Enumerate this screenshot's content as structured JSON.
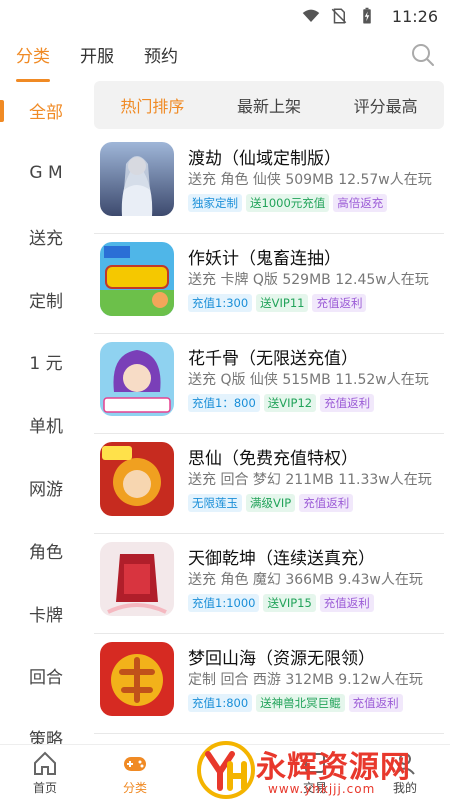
{
  "status_bar": {
    "time": "11:26",
    "icons": [
      "wifi-icon",
      "no-sim-icon",
      "battery-icon"
    ]
  },
  "top_tabs": [
    {
      "label": "分类",
      "active": true
    },
    {
      "label": "开服",
      "active": false
    },
    {
      "label": "预约",
      "active": false
    }
  ],
  "sidebar": {
    "items": [
      "全部",
      "G M",
      "送充",
      "定制",
      "1 元",
      "单机",
      "网游",
      "角色",
      "卡牌",
      "回合",
      "策略"
    ]
  },
  "sort_tabs": [
    {
      "label": "热门排序",
      "active": true
    },
    {
      "label": "最新上架",
      "active": false
    },
    {
      "label": "评分最高",
      "active": false
    }
  ],
  "games": [
    {
      "title": "渡劫（仙域定制版）",
      "meta": "送充 角色 仙侠  509MB  12.57w人在玩",
      "tags": [
        {
          "text": "独家定制",
          "color": "blue"
        },
        {
          "text": "送1000元充值",
          "color": "green"
        },
        {
          "text": "高倍返充",
          "color": "purple"
        }
      ]
    },
    {
      "title": "作妖计（鬼畜连抽）",
      "meta": "送充 卡牌 Q版  529MB  12.45w人在玩",
      "tags": [
        {
          "text": "充值1:300",
          "color": "blue"
        },
        {
          "text": "送VIP11",
          "color": "green"
        },
        {
          "text": "充值返利",
          "color": "purple"
        }
      ]
    },
    {
      "title": "花千骨（无限送充值）",
      "meta": "送充 Q版 仙侠  515MB  11.52w人在玩",
      "tags": [
        {
          "text": "充值1：800",
          "color": "blue"
        },
        {
          "text": "送VIP12",
          "color": "green"
        },
        {
          "text": "充值返利",
          "color": "purple"
        }
      ]
    },
    {
      "title": "思仙（免费充值特权）",
      "meta": "送充 回合 梦幻  211MB  11.33w人在玩",
      "tags": [
        {
          "text": "无限莲玉",
          "color": "blue"
        },
        {
          "text": "满级VIP",
          "color": "green"
        },
        {
          "text": "充值返利",
          "color": "purple"
        }
      ]
    },
    {
      "title": "天御乾坤（连续送真充）",
      "meta": "送充 角色 魔幻  366MB  9.43w人在玩",
      "tags": [
        {
          "text": "充值1:1000",
          "color": "blue"
        },
        {
          "text": "送VIP15",
          "color": "green"
        },
        {
          "text": "充值返利",
          "color": "purple"
        }
      ]
    },
    {
      "title": "梦回山海（资源无限领）",
      "meta": "定制 回合 西游  312MB  9.12w人在玩",
      "tags": [
        {
          "text": "充值1:800",
          "color": "blue"
        },
        {
          "text": "送神兽北冥巨鲲",
          "color": "green"
        },
        {
          "text": "充值返利",
          "color": "purple"
        }
      ]
    }
  ],
  "bottom_nav": [
    {
      "label": "首页",
      "icon": "home-icon",
      "active": false
    },
    {
      "label": "分类",
      "icon": "gamepad-icon",
      "active": true
    },
    {
      "label": "交易",
      "icon": "trade-icon",
      "active": false
    },
    {
      "label": "我的",
      "icon": "user-icon",
      "active": false
    }
  ],
  "watermark": {
    "text": "永辉资源网",
    "url": "www.yhkjjj.com"
  },
  "colors": {
    "accent": "#f08a24",
    "tag_blue": "#1a8fd8",
    "tag_green": "#22a35a",
    "tag_purple": "#9b5bd6"
  }
}
